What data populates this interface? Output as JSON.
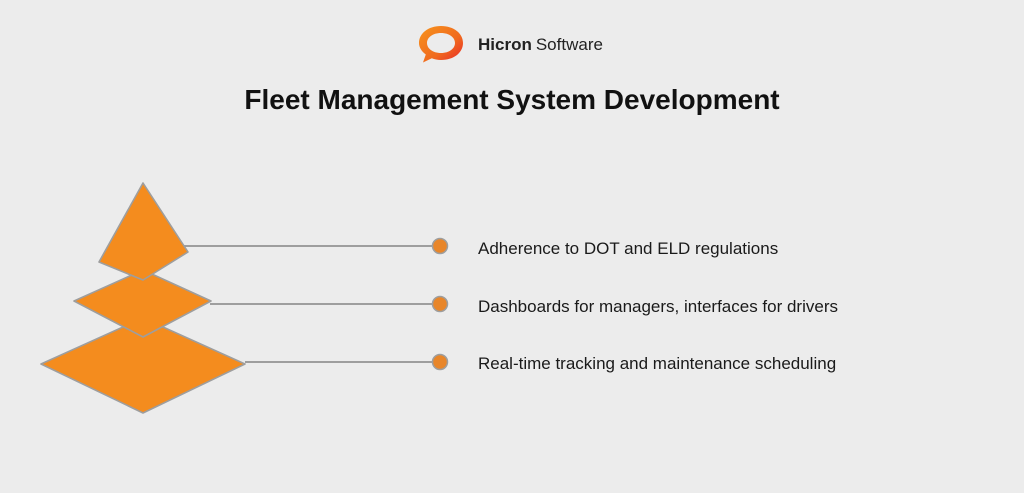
{
  "brand": {
    "name_bold": "Hicron",
    "name_regular": "Software",
    "logo_icon": "speech-bubble-ring-icon"
  },
  "title": "Fleet Management System Development",
  "colors": {
    "background": "#ececec",
    "shape_fill": "#f48c1e",
    "shape_stroke": "#9e9e9e",
    "connector": "#9e9e9e",
    "dot": "#e8862a",
    "logo_orange": "#f06a1e",
    "logo_red": "#e8262a"
  },
  "items": [
    {
      "label": "Adherence to DOT and ELD regulations"
    },
    {
      "label": "Dashboards for managers, interfaces for drivers"
    },
    {
      "label": "Real-time tracking and maintenance scheduling"
    }
  ]
}
